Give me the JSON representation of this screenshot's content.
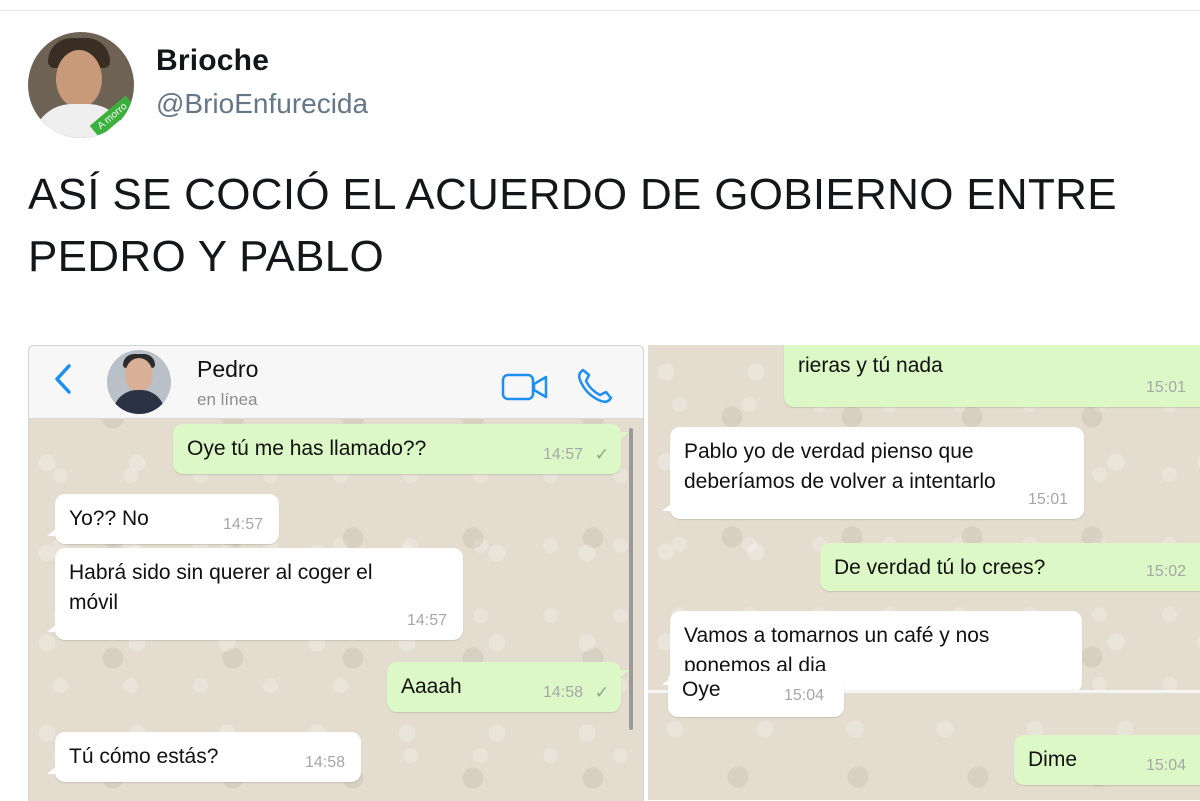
{
  "tweet": {
    "display_name": "Brioche",
    "handle": "@BrioEnfurecida",
    "avatar_badge": "A morro",
    "text": "ASÍ SE COCIÓ EL ACUERDO DE GOBIERNO ENTRE\nPEDRO Y PABLO"
  },
  "chat_left": {
    "contact_name": "Pedro",
    "contact_status": "en línea",
    "icons": {
      "back": "chevron-left-icon",
      "video": "video-call-icon",
      "phone": "phone-icon"
    },
    "messages": [
      {
        "text": "Oye tú me has llamado??",
        "time": "14:57",
        "check": "✓"
      },
      {
        "text": "Yo?? No",
        "time": "14:57"
      },
      {
        "text": "Habrá sido sin querer al coger el\nmóvil",
        "time": "14:57"
      },
      {
        "text": "Aaaah",
        "time": "14:58",
        "check": "✓"
      },
      {
        "text": "Tú cómo estás?",
        "time": "14:58"
      }
    ]
  },
  "chat_right": {
    "messages": [
      {
        "text": "rieras y tú nada",
        "time": "15:01",
        "check": "✓"
      },
      {
        "text": "Pablo yo de verdad pienso que\ndeberíamos de volver a intentarlo",
        "time": "15:01"
      },
      {
        "text": "De verdad tú lo crees?",
        "time": "15:02",
        "check": "✓"
      },
      {
        "text": "Vamos a tomarnos un café y nos\nponemos al dia",
        "time": ""
      },
      {
        "text": "Oye",
        "time": "15:04"
      },
      {
        "text": "Dime",
        "time": "15:04",
        "check": "✓"
      }
    ]
  },
  "colors": {
    "out_bubble": "#dcf8c6",
    "in_bubble": "#ffffff",
    "ios_blue": "#1d8ef2"
  }
}
